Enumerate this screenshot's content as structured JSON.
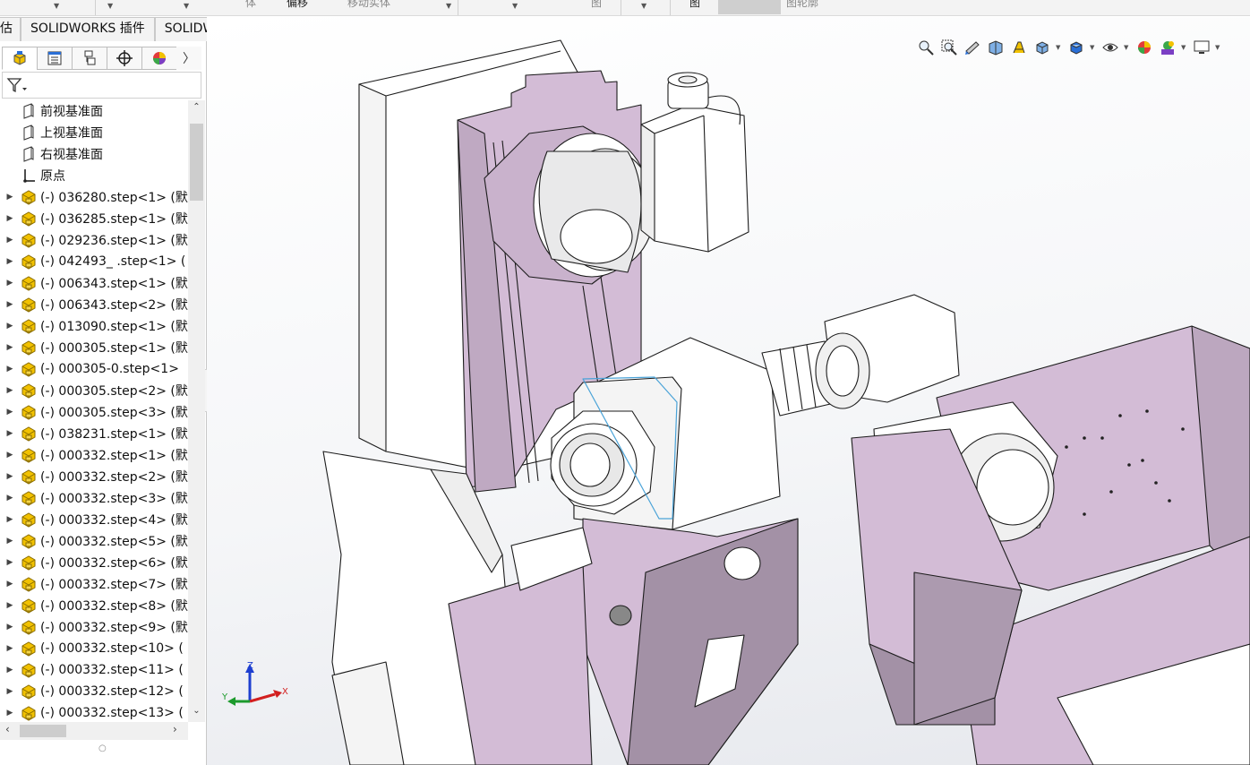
{
  "top_strip": {
    "labels": [
      "体",
      "偏移",
      "移动实体",
      "图",
      "图",
      "图轮廓"
    ]
  },
  "tabs": [
    "估",
    "SOLIDWORKS 插件",
    "SOLIDWORKS MBD"
  ],
  "panel": {
    "tab_icons": [
      "featuremanager-icon",
      "propertymanager-icon",
      "configurationmanager-icon",
      "dimxpert-icon",
      "display-manager-icon"
    ],
    "more_label": "〉",
    "tree_items": [
      {
        "label": "前视基准面",
        "icon": "plane-icon",
        "expandable": false
      },
      {
        "label": "上视基准面",
        "icon": "plane-icon",
        "expandable": false
      },
      {
        "label": "右视基准面",
        "icon": "plane-icon",
        "expandable": false
      },
      {
        "label": "原点",
        "icon": "origin-icon",
        "expandable": false
      },
      {
        "label": "(-) 036280.step<1> (默",
        "icon": "part-icon",
        "expandable": true
      },
      {
        "label": "(-) 036285.step<1> (默",
        "icon": "part-icon",
        "expandable": true
      },
      {
        "label": "(-) 029236.step<1> (默",
        "icon": "part-icon",
        "expandable": true
      },
      {
        "label": "(-) 042493_ .step<1> (",
        "icon": "part-icon",
        "expandable": true
      },
      {
        "label": "(-) 006343.step<1> (默",
        "icon": "part-icon",
        "expandable": true
      },
      {
        "label": "(-) 006343.step<2> (默",
        "icon": "part-icon",
        "expandable": true
      },
      {
        "label": "(-) 013090.step<1> (默",
        "icon": "part-icon",
        "expandable": true
      },
      {
        "label": "(-) 000305.step<1> (默",
        "icon": "part-icon",
        "expandable": true
      },
      {
        "label": "(-) 000305-0.step<1>",
        "icon": "part-icon",
        "expandable": true
      },
      {
        "label": "(-) 000305.step<2> (默",
        "icon": "part-icon",
        "expandable": true
      },
      {
        "label": "(-) 000305.step<3> (默",
        "icon": "part-icon",
        "expandable": true
      },
      {
        "label": "(-) 038231.step<1> (默",
        "icon": "part-icon",
        "expandable": true
      },
      {
        "label": "(-) 000332.step<1> (默",
        "icon": "part-icon",
        "expandable": true
      },
      {
        "label": "(-) 000332.step<2> (默",
        "icon": "part-icon",
        "expandable": true
      },
      {
        "label": "(-) 000332.step<3> (默",
        "icon": "part-icon",
        "expandable": true
      },
      {
        "label": "(-) 000332.step<4> (默",
        "icon": "part-icon",
        "expandable": true
      },
      {
        "label": "(-) 000332.step<5> (默",
        "icon": "part-icon",
        "expandable": true
      },
      {
        "label": "(-) 000332.step<6> (默",
        "icon": "part-icon",
        "expandable": true
      },
      {
        "label": "(-) 000332.step<7> (默",
        "icon": "part-icon",
        "expandable": true
      },
      {
        "label": "(-) 000332.step<8> (默",
        "icon": "part-icon",
        "expandable": true
      },
      {
        "label": "(-) 000332.step<9> (默",
        "icon": "part-icon",
        "expandable": true
      },
      {
        "label": "(-) 000332.step<10> (",
        "icon": "part-icon",
        "expandable": true
      },
      {
        "label": "(-) 000332.step<11> (",
        "icon": "part-icon",
        "expandable": true
      },
      {
        "label": "(-) 000332.step<12> (",
        "icon": "part-icon",
        "expandable": true
      },
      {
        "label": "(-) 000332.step<13> (",
        "icon": "part-icon",
        "expandable": true
      }
    ]
  },
  "view_toolbar": [
    "zoom-to-fit-icon",
    "zoom-to-area-icon",
    "previous-view-icon",
    "section-view-icon",
    "dynamic-annotation-icon",
    "view-orientation-icon",
    "display-style-icon",
    "hide-show-items-icon",
    "edit-appearance-icon",
    "apply-scene-icon",
    "view-settings-icon"
  ],
  "triad": {
    "x": "X",
    "y": "Y",
    "z": "Z"
  },
  "colors": {
    "machine_fill": "#d3bcd6",
    "machine_dark": "#a391a6",
    "edge": "#1c1c1c",
    "part_icon": "#f2c200"
  }
}
